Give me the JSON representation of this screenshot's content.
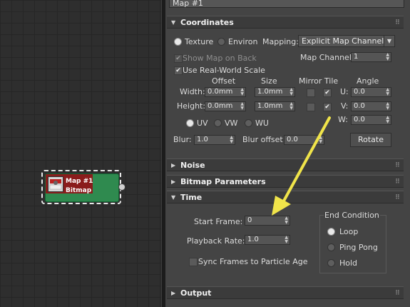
{
  "node_editor": {
    "node_title": "Map #1",
    "node_subtitle": "Bitmap"
  },
  "material_name": "Map #1",
  "rollouts": {
    "coordinates": "Coordinates",
    "noise": "Noise",
    "bitmap_parameters": "Bitmap Parameters",
    "time": "Time",
    "output": "Output"
  },
  "coordinates": {
    "texture_label": "Texture",
    "environ_label": "Environ",
    "mapping_label": "Mapping:",
    "mapping_value": "Explicit Map Channel",
    "show_map_on_back": "Show Map on Back",
    "map_channel_label": "Map Channel:",
    "map_channel_value": "1",
    "use_real_world_scale": "Use Real-World Scale",
    "col_offset": "Offset",
    "col_size": "Size",
    "col_mirror_tile": "Mirror Tile",
    "col_angle": "Angle",
    "width_label": "Width:",
    "width_offset": "0.0mm",
    "width_size": "1.0mm",
    "height_label": "Height:",
    "height_offset": "0.0mm",
    "height_size": "1.0mm",
    "u_label": "U:",
    "u_value": "0.0",
    "v_label": "V:",
    "v_value": "0.0",
    "w_label": "W:",
    "w_value": "0.0",
    "uv_label": "UV",
    "vw_label": "VW",
    "wu_label": "WU",
    "blur_label": "Blur:",
    "blur_value": "1.0",
    "blur_offset_label": "Blur offset:",
    "blur_offset_value": "0.0",
    "rotate_button": "Rotate"
  },
  "time": {
    "start_frame_label": "Start Frame:",
    "start_frame_value": "0",
    "playback_rate_label": "Playback Rate:",
    "playback_rate_value": "1.0",
    "sync_frames_label": "Sync Frames to Particle Age",
    "end_condition_label": "End Condition",
    "loop_label": "Loop",
    "ping_pong_label": "Ping Pong",
    "hold_label": "Hold"
  },
  "colors": {
    "annotation_arrow": "#f0e44a",
    "node_header": "#8a1c1c",
    "node_body": "#2f8a4f"
  }
}
